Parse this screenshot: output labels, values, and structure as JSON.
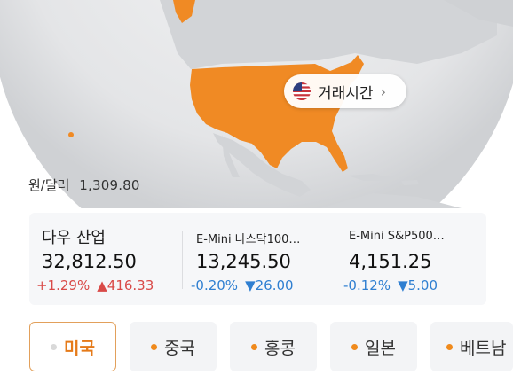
{
  "map": {
    "trading_hours_button": "거래시간",
    "chevron": "›",
    "flag_icon": "us-flag-icon",
    "highlight_color": "#f08a24"
  },
  "fx": {
    "label": "원/달러",
    "value": "1,309.80"
  },
  "indices": [
    {
      "name": "다우 산업",
      "price": "32,812.50",
      "change_pct": "+1.29%",
      "change_abs": "▲416.33",
      "direction": "up"
    },
    {
      "name": "E-Mini 나스닥100…",
      "price": "13,245.50",
      "change_pct": "-0.20%",
      "change_abs": "▼26.00",
      "direction": "down"
    },
    {
      "name": "E-Mini S&P500…",
      "price": "4,151.25",
      "change_pct": "-0.12%",
      "change_abs": "▼5.00",
      "direction": "down"
    }
  ],
  "markets": [
    {
      "label": "미국",
      "active": true
    },
    {
      "label": "중국",
      "active": false
    },
    {
      "label": "홍콩",
      "active": false
    },
    {
      "label": "일본",
      "active": false
    },
    {
      "label": "베트남",
      "active": false
    }
  ],
  "colors": {
    "up": "#d94a48",
    "down": "#2f7fd1",
    "accent": "#f08a1c"
  }
}
